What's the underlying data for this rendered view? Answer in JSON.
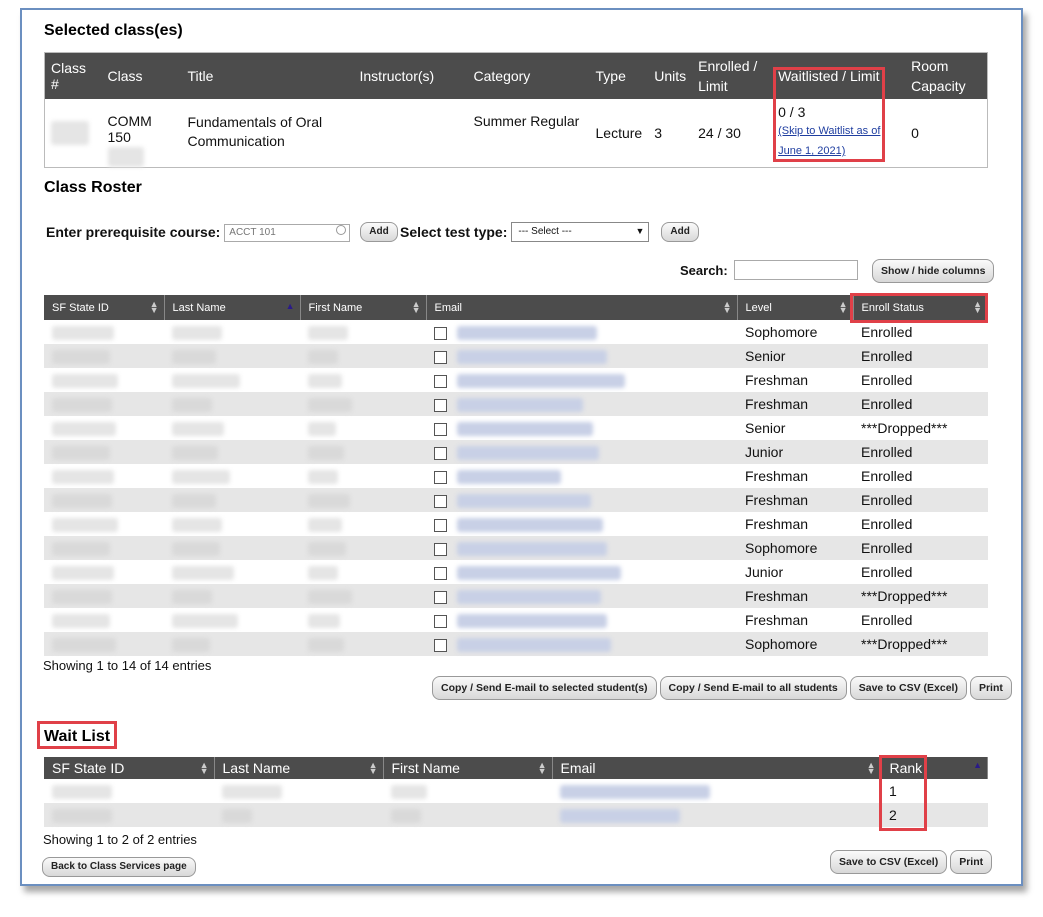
{
  "selected": {
    "heading": "Selected class(es)",
    "headers": [
      "Class #",
      "Class",
      "Title",
      "Instructor(s)",
      "Category",
      "Type",
      "Units",
      "Enrolled / Limit",
      "Waitlisted / Limit",
      "Room Capacity"
    ],
    "row": {
      "class": "COMM 150",
      "title": "Fundamentals of Oral Communication",
      "category": "Summer Regular",
      "type": "Lecture",
      "units": "3",
      "enrolled": "24 / 30",
      "waitlisted": "0 / 3",
      "waitlist_link": "(Skip to Waitlist as of June 1, 2021)",
      "room_capacity": "0"
    }
  },
  "roster": {
    "heading": "Class Roster",
    "prereq_label": "Enter prerequisite course:",
    "prereq_placeholder": "ACCT 101",
    "add_label": "Add",
    "test_label": "Select test type:",
    "test_selected": "--- Select ---",
    "search_label": "Search:",
    "show_hide_label": "Show / hide columns",
    "headers": [
      "SF State ID",
      "Last Name",
      "First Name",
      "Email",
      "Level",
      "Enroll Status"
    ],
    "rows": [
      {
        "level": "Sophomore",
        "status": "Enrolled"
      },
      {
        "level": "Senior",
        "status": "Enrolled"
      },
      {
        "level": "Freshman",
        "status": "Enrolled"
      },
      {
        "level": "Freshman",
        "status": "Enrolled"
      },
      {
        "level": "Senior",
        "status": "***Dropped***"
      },
      {
        "level": "Junior",
        "status": "Enrolled"
      },
      {
        "level": "Freshman",
        "status": "Enrolled"
      },
      {
        "level": "Freshman",
        "status": "Enrolled"
      },
      {
        "level": "Freshman",
        "status": "Enrolled"
      },
      {
        "level": "Sophomore",
        "status": "Enrolled"
      },
      {
        "level": "Junior",
        "status": "Enrolled"
      },
      {
        "level": "Freshman",
        "status": "***Dropped***"
      },
      {
        "level": "Freshman",
        "status": "Enrolled"
      },
      {
        "level": "Sophomore",
        "status": "***Dropped***"
      }
    ],
    "showing": "Showing 1 to 14 of 14 entries",
    "btn_email_selected": "Copy / Send E-mail to selected student(s)",
    "btn_email_all": "Copy / Send E-mail to all students",
    "btn_csv": "Save to CSV (Excel)",
    "btn_print": "Print"
  },
  "waitlist": {
    "heading": "Wait List",
    "headers": [
      "SF State ID",
      "Last Name",
      "First Name",
      "Email",
      "Rank"
    ],
    "ranks": [
      "1",
      "2"
    ],
    "showing": "Showing 1 to 2 of 2 entries",
    "btn_back": "Back to Class Services page",
    "btn_csv": "Save to CSV (Excel)",
    "btn_print": "Print"
  },
  "colors": {
    "header_bg": "#4c4c4c",
    "highlight": "#e04048",
    "link": "#1f3ea0",
    "frame": "#6b8fc0"
  }
}
